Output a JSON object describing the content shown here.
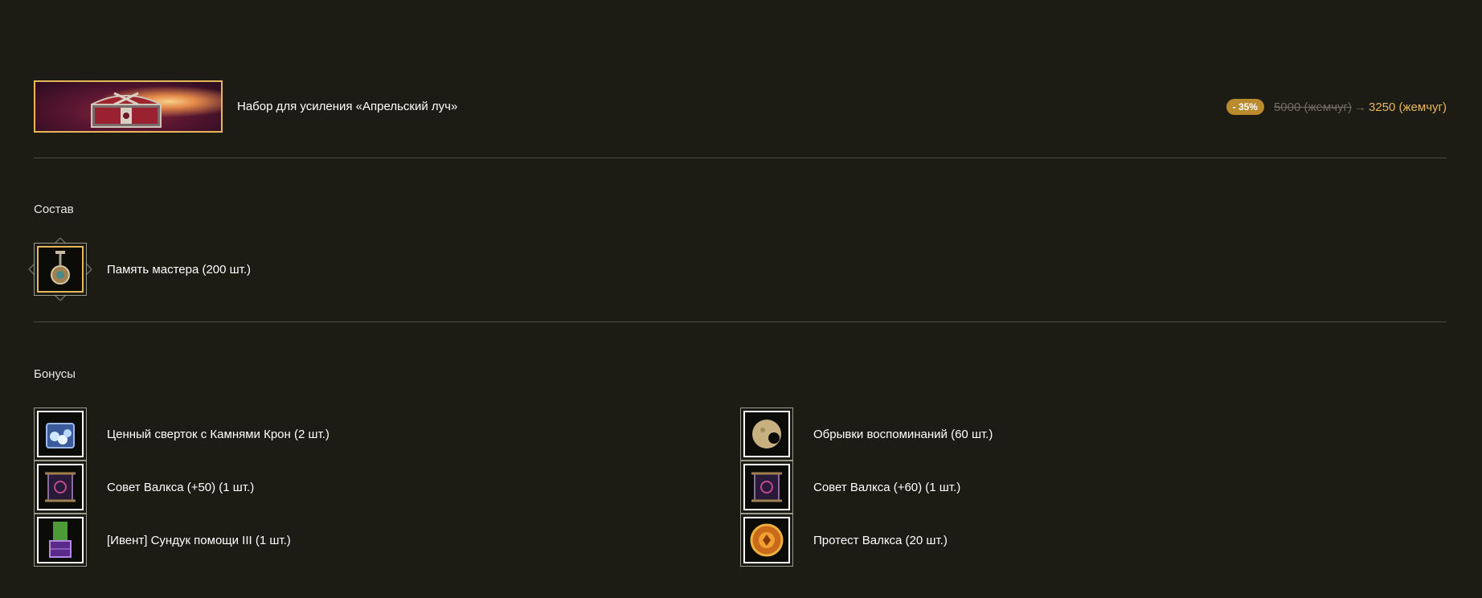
{
  "pack": {
    "title": "Набор для усиления «Апрельский луч»",
    "discount": "- 35%",
    "old_price": "5000 (жемчуг)",
    "arrow": "→",
    "new_price": "3250 (жемчуг)"
  },
  "composition": {
    "title": "Состав",
    "items": [
      {
        "label": "Память мастера (200 шт.)",
        "icon": "master-memory-pendant-icon"
      }
    ]
  },
  "bonuses": {
    "title": "Бонусы",
    "left": [
      {
        "label": "Ценный сверток с Камнями Крон (2 шт.)",
        "icon": "crown-stones-bundle-icon"
      },
      {
        "label": "Совет Валкса (+50) (1 шт.)",
        "icon": "valks-scroll-icon"
      },
      {
        "label": "[Ивент] Сундук помощи III (1 шт.)",
        "icon": "help-chest-icon"
      }
    ],
    "right": [
      {
        "label": "Обрывки воспоминаний (60 шт.)",
        "icon": "memory-fragments-icon"
      },
      {
        "label": "Совет Валкса (+60) (1 шт.)",
        "icon": "valks-scroll-icon"
      },
      {
        "label": "Протест Валкса (20 шт.)",
        "icon": "valks-protest-coin-icon"
      }
    ]
  },
  "colors": {
    "background": "#1c1b14",
    "accent_gold": "#e7b75c",
    "discount_badge": "#b98a2e",
    "muted_price": "#6f6c62",
    "divider": "#4a4a3e"
  }
}
